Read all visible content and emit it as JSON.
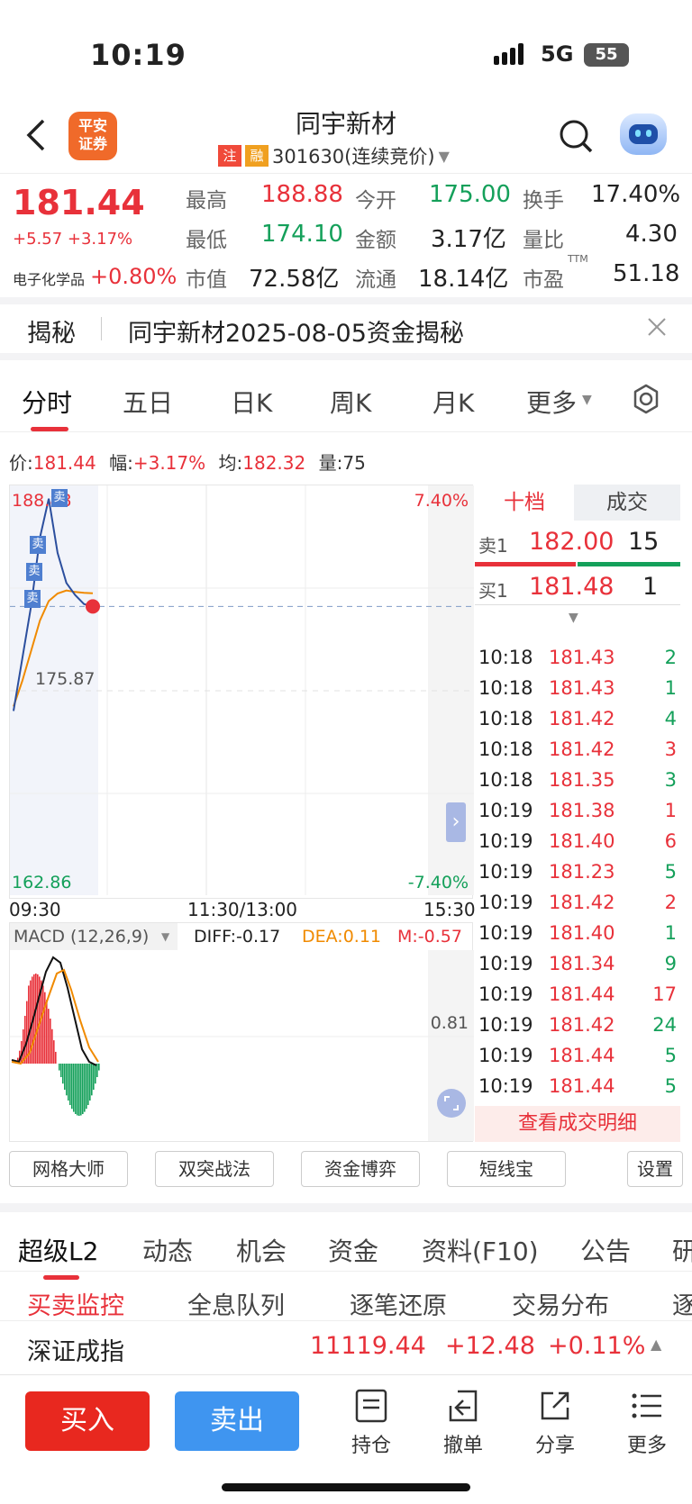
{
  "status": {
    "time": "10:19",
    "network": "5G",
    "battery": "55"
  },
  "header": {
    "logo_line1": "平安",
    "logo_line2": "证券",
    "name": "同宇新材",
    "tag1": "注",
    "tag2": "融",
    "code": "301630(连续竞价)"
  },
  "quote": {
    "price": "181.44",
    "change": "+5.57 +3.17%",
    "sector": "电子化学品",
    "sector_pct": "+0.80%",
    "labels": {
      "high": "最高",
      "open": "今开",
      "turnover": "换手",
      "low": "最低",
      "amount": "金额",
      "vol_ratio": "量比",
      "mktcap": "市值",
      "float": "流通",
      "pe": "市盈",
      "pe_sup": "TTM"
    },
    "values": {
      "high": "188.88",
      "open": "175.00",
      "turnover": "17.40%",
      "low": "174.10",
      "amount": "3.17亿",
      "vol_ratio": "4.30",
      "mktcap": "72.58亿",
      "float": "18.14亿",
      "pe": "51.18"
    }
  },
  "reveal": {
    "label": "揭秘",
    "text": "同宇新材2025-08-05资金揭秘"
  },
  "periods": [
    "分时",
    "五日",
    "日K",
    "周K",
    "月K",
    "更多"
  ],
  "infoline": {
    "price_label": "价:",
    "price": "181.44",
    "amp_label": "幅:",
    "amp": "+3.17%",
    "avg_label": "均:",
    "avg": "182.32",
    "vol_label": "量:",
    "vol": "75"
  },
  "chart": {
    "y_top": "188.88",
    "y_mid": "175.87",
    "y_bottom": "162.86",
    "pct_top": "7.40%",
    "pct_bottom": "-7.40%",
    "time_start": "09:30",
    "time_mid": "11:30/13:00",
    "time_end": "15:30",
    "sell_mark": "卖",
    "macd_label": "MACD (12,26,9)",
    "diff": "DIFF:-0.17",
    "dea": "DEA:0.11",
    "m": "M:-0.57",
    "macd_axis": "0.81"
  },
  "chart_data": {
    "type": "line",
    "series": [
      {
        "values": [
          174.5,
          178.0,
          181.5,
          186.0,
          188.6,
          185.0,
          183.0,
          182.2,
          181.6,
          181.44
        ]
      },
      {
        "values": [
          174.8,
          176.5,
          178.5,
          180.5,
          181.8,
          182.3,
          182.5,
          182.4,
          182.35,
          182.32
        ]
      }
    ],
    "ylim": [
      162.86,
      188.88
    ],
    "xlabel": "",
    "ylabel": ""
  },
  "book": {
    "tab_levels": "十档",
    "tab_trades": "成交",
    "ask_label": "卖1",
    "ask_price": "182.00",
    "ask_vol": "15",
    "bid_label": "买1",
    "bid_price": "181.48",
    "bid_vol": "1",
    "detail_link": "查看成交明细",
    "trades": [
      {
        "t": "10:18",
        "p": "181.43",
        "v": "2",
        "side": "g"
      },
      {
        "t": "10:18",
        "p": "181.43",
        "v": "1",
        "side": "g"
      },
      {
        "t": "10:18",
        "p": "181.42",
        "v": "4",
        "side": "g"
      },
      {
        "t": "10:18",
        "p": "181.42",
        "v": "3",
        "side": "r"
      },
      {
        "t": "10:18",
        "p": "181.35",
        "v": "3",
        "side": "g"
      },
      {
        "t": "10:19",
        "p": "181.38",
        "v": "1",
        "side": "r"
      },
      {
        "t": "10:19",
        "p": "181.40",
        "v": "6",
        "side": "r"
      },
      {
        "t": "10:19",
        "p": "181.23",
        "v": "5",
        "side": "g"
      },
      {
        "t": "10:19",
        "p": "181.42",
        "v": "2",
        "side": "r"
      },
      {
        "t": "10:19",
        "p": "181.40",
        "v": "1",
        "side": "g"
      },
      {
        "t": "10:19",
        "p": "181.34",
        "v": "9",
        "side": "g"
      },
      {
        "t": "10:19",
        "p": "181.44",
        "v": "17",
        "side": "r"
      },
      {
        "t": "10:19",
        "p": "181.42",
        "v": "24",
        "side": "g"
      },
      {
        "t": "10:19",
        "p": "181.44",
        "v": "5",
        "side": "g"
      },
      {
        "t": "10:19",
        "p": "181.44",
        "v": "5",
        "side": "g"
      }
    ]
  },
  "tools": [
    "网格大师",
    "双突战法",
    "资金博弈",
    "短线宝",
    "设置"
  ],
  "section_tabs": [
    "超级L2",
    "动态",
    "机会",
    "资金",
    "资料(F10)",
    "公告",
    "研"
  ],
  "sub_tabs": [
    "买卖监控",
    "全息队列",
    "逐笔还原",
    "交易分布",
    "逐"
  ],
  "index": {
    "name": "深证成指",
    "value": "11119.44",
    "change": "+12.48",
    "pct": "+0.11%"
  },
  "bottom": {
    "buy": "买入",
    "sell": "卖出",
    "nav": [
      "持仓",
      "撤单",
      "分享",
      "更多"
    ]
  }
}
